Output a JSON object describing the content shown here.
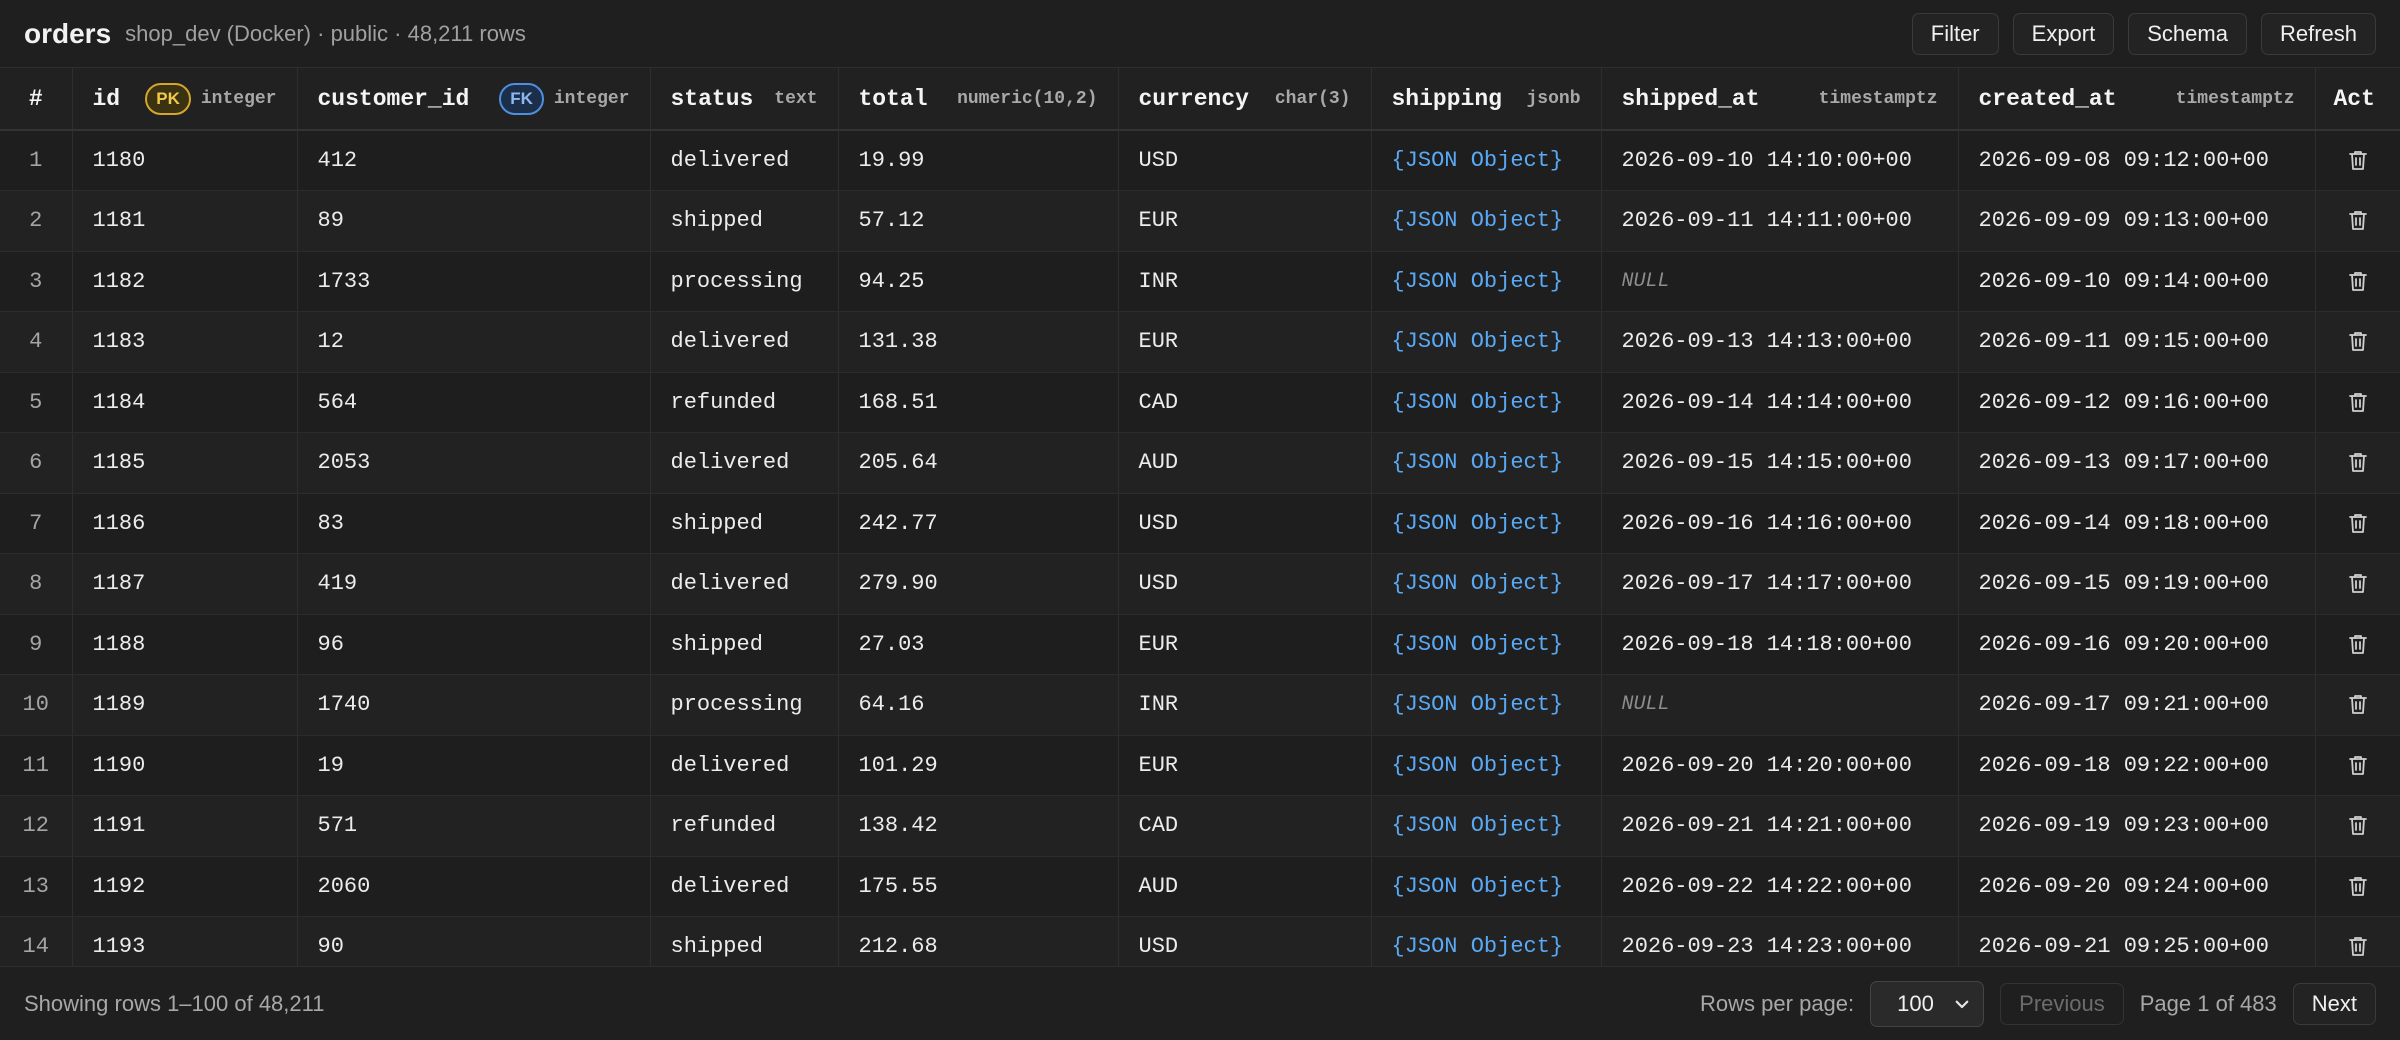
{
  "header": {
    "title": "orders",
    "subtitle": "shop_dev (Docker) · public · 48,211 rows",
    "actions": [
      "Filter",
      "Export",
      "Schema",
      "Refresh"
    ]
  },
  "table": {
    "columns": [
      {
        "name": "#",
        "type": ""
      },
      {
        "name": "id",
        "type": "integer",
        "badge": "PK"
      },
      {
        "name": "customer_id",
        "type": "integer",
        "badge": "FK"
      },
      {
        "name": "status",
        "type": "text"
      },
      {
        "name": "total",
        "type": "numeric(10,2)"
      },
      {
        "name": "currency",
        "type": "char(3)"
      },
      {
        "name": "shipping",
        "type": "jsonb"
      },
      {
        "name": "shipped_at",
        "type": "timestamptz"
      },
      {
        "name": "created_at",
        "type": "timestamptz"
      },
      {
        "name": "Act",
        "type": ""
      }
    ],
    "rows": [
      [
        "1",
        "1180",
        "412",
        "delivered",
        "19.99",
        "USD",
        "{JSON Object}",
        "2026-09-10 14:10:00+00",
        "2026-09-08 09:12:00+00"
      ],
      [
        "2",
        "1181",
        "89",
        "shipped",
        "57.12",
        "EUR",
        "{JSON Object}",
        "2026-09-11 14:11:00+00",
        "2026-09-09 09:13:00+00"
      ],
      [
        "3",
        "1182",
        "1733",
        "processing",
        "94.25",
        "INR",
        "{JSON Object}",
        "NULL",
        "2026-09-10 09:14:00+00"
      ],
      [
        "4",
        "1183",
        "12",
        "delivered",
        "131.38",
        "EUR",
        "{JSON Object}",
        "2026-09-13 14:13:00+00",
        "2026-09-11 09:15:00+00"
      ],
      [
        "5",
        "1184",
        "564",
        "refunded",
        "168.51",
        "CAD",
        "{JSON Object}",
        "2026-09-14 14:14:00+00",
        "2026-09-12 09:16:00+00"
      ],
      [
        "6",
        "1185",
        "2053",
        "delivered",
        "205.64",
        "AUD",
        "{JSON Object}",
        "2026-09-15 14:15:00+00",
        "2026-09-13 09:17:00+00"
      ],
      [
        "7",
        "1186",
        "83",
        "shipped",
        "242.77",
        "USD",
        "{JSON Object}",
        "2026-09-16 14:16:00+00",
        "2026-09-14 09:18:00+00"
      ],
      [
        "8",
        "1187",
        "419",
        "delivered",
        "279.90",
        "USD",
        "{JSON Object}",
        "2026-09-17 14:17:00+00",
        "2026-09-15 09:19:00+00"
      ],
      [
        "9",
        "1188",
        "96",
        "shipped",
        "27.03",
        "EUR",
        "{JSON Object}",
        "2026-09-18 14:18:00+00",
        "2026-09-16 09:20:00+00"
      ],
      [
        "10",
        "1189",
        "1740",
        "processing",
        "64.16",
        "INR",
        "{JSON Object}",
        "NULL",
        "2026-09-17 09:21:00+00"
      ],
      [
        "11",
        "1190",
        "19",
        "delivered",
        "101.29",
        "EUR",
        "{JSON Object}",
        "2026-09-20 14:20:00+00",
        "2026-09-18 09:22:00+00"
      ],
      [
        "12",
        "1191",
        "571",
        "refunded",
        "138.42",
        "CAD",
        "{JSON Object}",
        "2026-09-21 14:21:00+00",
        "2026-09-19 09:23:00+00"
      ],
      [
        "13",
        "1192",
        "2060",
        "delivered",
        "175.55",
        "AUD",
        "{JSON Object}",
        "2026-09-22 14:22:00+00",
        "2026-09-20 09:24:00+00"
      ],
      [
        "14",
        "1193",
        "90",
        "shipped",
        "212.68",
        "USD",
        "{JSON Object}",
        "2026-09-23 14:23:00+00",
        "2026-09-21 09:25:00+00"
      ]
    ],
    "row_action_icon": "trash-icon"
  },
  "footer": {
    "status": "Showing rows 1–100 of 48,211",
    "rows_per_page_label": "Rows per page:",
    "rows_per_page_value": "100",
    "previous_label": "Previous",
    "page_info": "Page 1 of 483",
    "next_label": "Next"
  },
  "colors": {
    "background": "#1c1c1c",
    "json_link": "#5aa9f5",
    "pk_badge": "#d4a72c",
    "fk_badge": "#4f8fe0"
  }
}
